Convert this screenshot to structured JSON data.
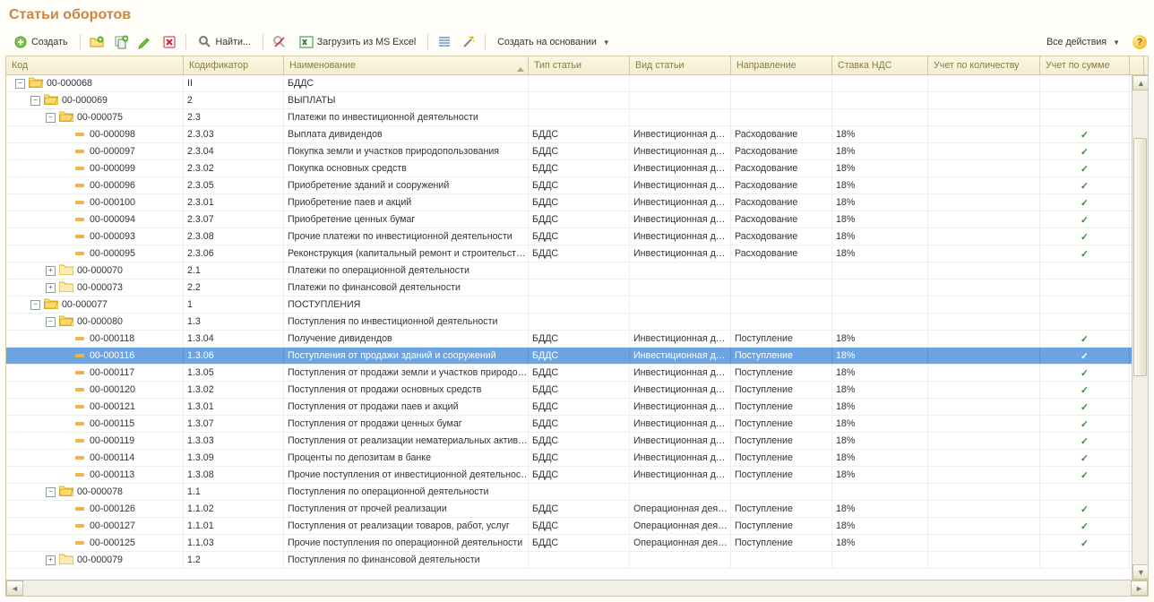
{
  "title": "Статьи оборотов",
  "toolbar": {
    "create": "Создать",
    "find": "Найти...",
    "loadExcel": "Загрузить из MS Excel",
    "createBasedOn": "Создать на основании",
    "allActions": "Все действия"
  },
  "columns": {
    "code": "Код",
    "codifier": "Кодификатор",
    "name": "Наименование",
    "articleType": "Тип статьи",
    "articleKind": "Вид статьи",
    "direction": "Направление",
    "vatRate": "Ставка НДС",
    "qtyAccounting": "Учет по количеству",
    "sumAccounting": "Учет по сумме"
  },
  "selectedCode": "00-000116",
  "tree": [
    {
      "lvl": 0,
      "t": "fo",
      "code": "00-000068",
      "cod": "II",
      "name": "БДДС"
    },
    {
      "lvl": 1,
      "t": "fo",
      "code": "00-000069",
      "cod": "2",
      "name": "ВЫПЛАТЫ"
    },
    {
      "lvl": 2,
      "t": "fo",
      "code": "00-000075",
      "cod": "2.3",
      "name": "Платежи по инвестиционной деятельности"
    },
    {
      "lvl": 3,
      "t": "it",
      "code": "00-000098",
      "cod": "2.3.03",
      "name": "Выплата дивидендов",
      "at": "БДДС",
      "ak": "Инвестиционная д…",
      "dir": "Расходование",
      "vat": "18%",
      "sum": true
    },
    {
      "lvl": 3,
      "t": "it",
      "code": "00-000097",
      "cod": "2.3.04",
      "name": "Покупка земли и участков природопользования",
      "at": "БДДС",
      "ak": "Инвестиционная д…",
      "dir": "Расходование",
      "vat": "18%",
      "sum": true
    },
    {
      "lvl": 3,
      "t": "it",
      "code": "00-000099",
      "cod": "2.3.02",
      "name": "Покупка основных средств",
      "at": "БДДС",
      "ak": "Инвестиционная д…",
      "dir": "Расходование",
      "vat": "18%",
      "sum": true
    },
    {
      "lvl": 3,
      "t": "it",
      "code": "00-000096",
      "cod": "2.3.05",
      "name": "Приобретение зданий и сооружений",
      "at": "БДДС",
      "ak": "Инвестиционная д…",
      "dir": "Расходование",
      "vat": "18%",
      "sum": true
    },
    {
      "lvl": 3,
      "t": "it",
      "code": "00-000100",
      "cod": "2.3.01",
      "name": "Приобретение паев и акций",
      "at": "БДДС",
      "ak": "Инвестиционная д…",
      "dir": "Расходование",
      "vat": "18%",
      "sum": true
    },
    {
      "lvl": 3,
      "t": "it",
      "code": "00-000094",
      "cod": "2.3.07",
      "name": "Приобретение ценных бумаг",
      "at": "БДДС",
      "ak": "Инвестиционная д…",
      "dir": "Расходование",
      "vat": "18%",
      "sum": true
    },
    {
      "lvl": 3,
      "t": "it",
      "code": "00-000093",
      "cod": "2.3.08",
      "name": "Прочие платежи по инвестиционной деятельности",
      "at": "БДДС",
      "ak": "Инвестиционная д…",
      "dir": "Расходование",
      "vat": "18%",
      "sum": true
    },
    {
      "lvl": 3,
      "t": "it",
      "code": "00-000095",
      "cod": "2.3.06",
      "name": "Реконструкция (капитальный ремонт и строительст…",
      "at": "БДДС",
      "ak": "Инвестиционная д…",
      "dir": "Расходование",
      "vat": "18%",
      "sum": true
    },
    {
      "lvl": 2,
      "t": "fc",
      "code": "00-000070",
      "cod": "2.1",
      "name": "Платежи по операционной деятельности"
    },
    {
      "lvl": 2,
      "t": "fc",
      "code": "00-000073",
      "cod": "2.2",
      "name": "Платежи по финансовой деятельности"
    },
    {
      "lvl": 1,
      "t": "fo",
      "code": "00-000077",
      "cod": "1",
      "name": "ПОСТУПЛЕНИЯ"
    },
    {
      "lvl": 2,
      "t": "fo",
      "code": "00-000080",
      "cod": "1.3",
      "name": "Поступления по инвестиционной деятельности"
    },
    {
      "lvl": 3,
      "t": "it",
      "code": "00-000118",
      "cod": "1.3.04",
      "name": "Получение дивидендов",
      "at": "БДДС",
      "ak": "Инвестиционная д…",
      "dir": "Поступление",
      "vat": "18%",
      "sum": true
    },
    {
      "lvl": 3,
      "t": "it",
      "code": "00-000116",
      "cod": "1.3.06",
      "name": "Поступления от продажи зданий и сооружений",
      "at": "БДДС",
      "ak": "Инвестиционная д…",
      "dir": "Поступление",
      "vat": "18%",
      "sum": true
    },
    {
      "lvl": 3,
      "t": "it",
      "code": "00-000117",
      "cod": "1.3.05",
      "name": "Поступления от продажи земли и участков природо…",
      "at": "БДДС",
      "ak": "Инвестиционная д…",
      "dir": "Поступление",
      "vat": "18%",
      "sum": true
    },
    {
      "lvl": 3,
      "t": "it",
      "code": "00-000120",
      "cod": "1.3.02",
      "name": "Поступления от продажи основных средств",
      "at": "БДДС",
      "ak": "Инвестиционная д…",
      "dir": "Поступление",
      "vat": "18%",
      "sum": true
    },
    {
      "lvl": 3,
      "t": "it",
      "code": "00-000121",
      "cod": "1.3.01",
      "name": "Поступления от продажи паев и акций",
      "at": "БДДС",
      "ak": "Инвестиционная д…",
      "dir": "Поступление",
      "vat": "18%",
      "sum": true
    },
    {
      "lvl": 3,
      "t": "it",
      "code": "00-000115",
      "cod": "1.3.07",
      "name": "Поступления от продажи ценных бумаг",
      "at": "БДДС",
      "ak": "Инвестиционная д…",
      "dir": "Поступление",
      "vat": "18%",
      "sum": true
    },
    {
      "lvl": 3,
      "t": "it",
      "code": "00-000119",
      "cod": "1.3.03",
      "name": "Поступления от реализации нематериальных актив…",
      "at": "БДДС",
      "ak": "Инвестиционная д…",
      "dir": "Поступление",
      "vat": "18%",
      "sum": true
    },
    {
      "lvl": 3,
      "t": "it",
      "code": "00-000114",
      "cod": "1.3.09",
      "name": "Проценты по депозитам в банке",
      "at": "БДДС",
      "ak": "Инвестиционная д…",
      "dir": "Поступление",
      "vat": "18%",
      "sum": true
    },
    {
      "lvl": 3,
      "t": "it",
      "code": "00-000113",
      "cod": "1.3.08",
      "name": "Прочие поступления от инвестиционной деятельнос…",
      "at": "БДДС",
      "ak": "Инвестиционная д…",
      "dir": "Поступление",
      "vat": "18%",
      "sum": true
    },
    {
      "lvl": 2,
      "t": "fo",
      "code": "00-000078",
      "cod": "1.1",
      "name": "Поступления по операционной деятельности"
    },
    {
      "lvl": 3,
      "t": "it",
      "code": "00-000126",
      "cod": "1.1.02",
      "name": "Поступления от прочей реализации",
      "at": "БДДС",
      "ak": "Операционная дея…",
      "dir": "Поступление",
      "vat": "18%",
      "sum": true
    },
    {
      "lvl": 3,
      "t": "it",
      "code": "00-000127",
      "cod": "1.1.01",
      "name": "Поступления от реализации товаров, работ, услуг",
      "at": "БДДС",
      "ak": "Операционная дея…",
      "dir": "Поступление",
      "vat": "18%",
      "sum": true
    },
    {
      "lvl": 3,
      "t": "it",
      "code": "00-000125",
      "cod": "1.1.03",
      "name": "Прочие поступления по операционной деятельности",
      "at": "БДДС",
      "ak": "Операционная дея…",
      "dir": "Поступление",
      "vat": "18%",
      "sum": true
    },
    {
      "lvl": 2,
      "t": "fc",
      "code": "00-000079",
      "cod": "1.2",
      "name": "Поступления по финансовой деятельности"
    }
  ]
}
